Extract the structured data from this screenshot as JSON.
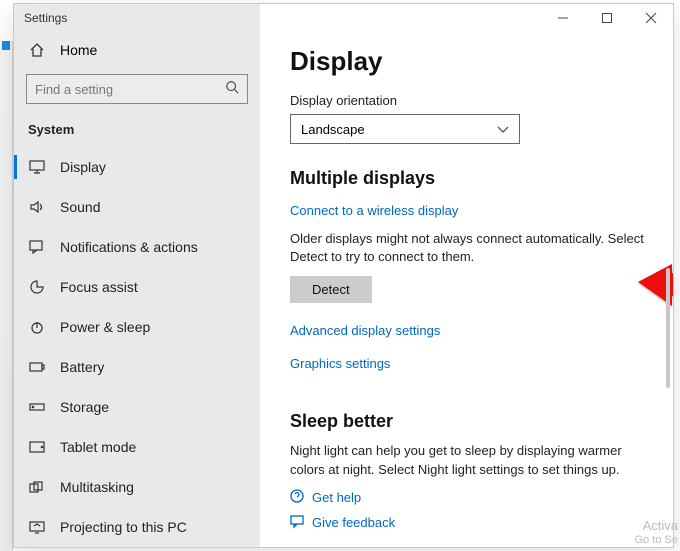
{
  "window": {
    "title": "Settings"
  },
  "home_label": "Home",
  "search": {
    "placeholder": "Find a setting"
  },
  "category": "System",
  "sidebar": {
    "items": [
      {
        "label": "Display"
      },
      {
        "label": "Sound"
      },
      {
        "label": "Notifications & actions"
      },
      {
        "label": "Focus assist"
      },
      {
        "label": "Power & sleep"
      },
      {
        "label": "Battery"
      },
      {
        "label": "Storage"
      },
      {
        "label": "Tablet mode"
      },
      {
        "label": "Multitasking"
      },
      {
        "label": "Projecting to this PC"
      }
    ]
  },
  "page": {
    "heading": "Display",
    "orientation_label": "Display orientation",
    "orientation_value": "Landscape",
    "multi_heading": "Multiple displays",
    "wireless_link": "Connect to a wireless display",
    "detect_text": "Older displays might not always connect automatically. Select Detect to try to connect to them.",
    "detect_button": "Detect",
    "advanced_link": "Advanced display settings",
    "graphics_link": "Graphics settings",
    "sleep_heading": "Sleep better",
    "sleep_text": "Night light can help you get to sleep by displaying warmer colors at night. Select Night light settings to set things up.",
    "gethelp": "Get help",
    "feedback": "Give feedback"
  },
  "watermark": {
    "line1": "Activa",
    "line2": "Go to Se"
  }
}
